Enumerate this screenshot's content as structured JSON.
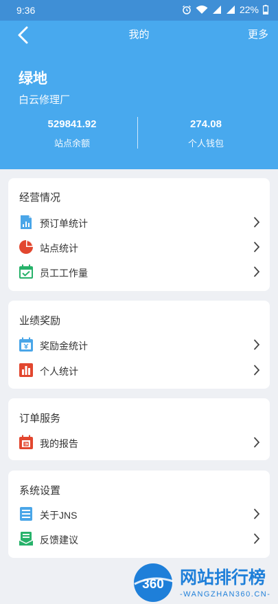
{
  "status_bar": {
    "time": "9:36",
    "battery": "22%"
  },
  "nav": {
    "title": "我的",
    "more": "更多"
  },
  "profile": {
    "name": "绿地",
    "subtitle": "白云修理厂"
  },
  "stats": [
    {
      "value": "529841.92",
      "label": "站点余额"
    },
    {
      "value": "274.08",
      "label": "个人钱包"
    }
  ],
  "sections": [
    {
      "title": "经营情况",
      "items": [
        {
          "label": "预订单统计",
          "icon": "bar-report-icon"
        },
        {
          "label": "站点统计",
          "icon": "pie-chart-icon"
        },
        {
          "label": "员工工作量",
          "icon": "calendar-check-icon"
        }
      ]
    },
    {
      "title": "业绩奖励",
      "items": [
        {
          "label": "奖励金统计",
          "icon": "reward-calendar-icon"
        },
        {
          "label": "个人统计",
          "icon": "bar-chart-icon"
        }
      ]
    },
    {
      "title": "订单服务",
      "items": [
        {
          "label": "我的报告",
          "icon": "report-calendar-icon"
        }
      ]
    },
    {
      "title": "系统设置",
      "items": [
        {
          "label": "关于JNS",
          "icon": "document-icon"
        },
        {
          "label": "反馈建议",
          "icon": "feedback-icon"
        }
      ]
    }
  ],
  "watermark": {
    "logo_text": "360",
    "name": "网站排行榜",
    "domain": "-WANGZHAN360.CN-"
  },
  "colors": {
    "header": "#48a9ee",
    "status_bar": "#3f8fd6",
    "background": "#eef0f4"
  }
}
